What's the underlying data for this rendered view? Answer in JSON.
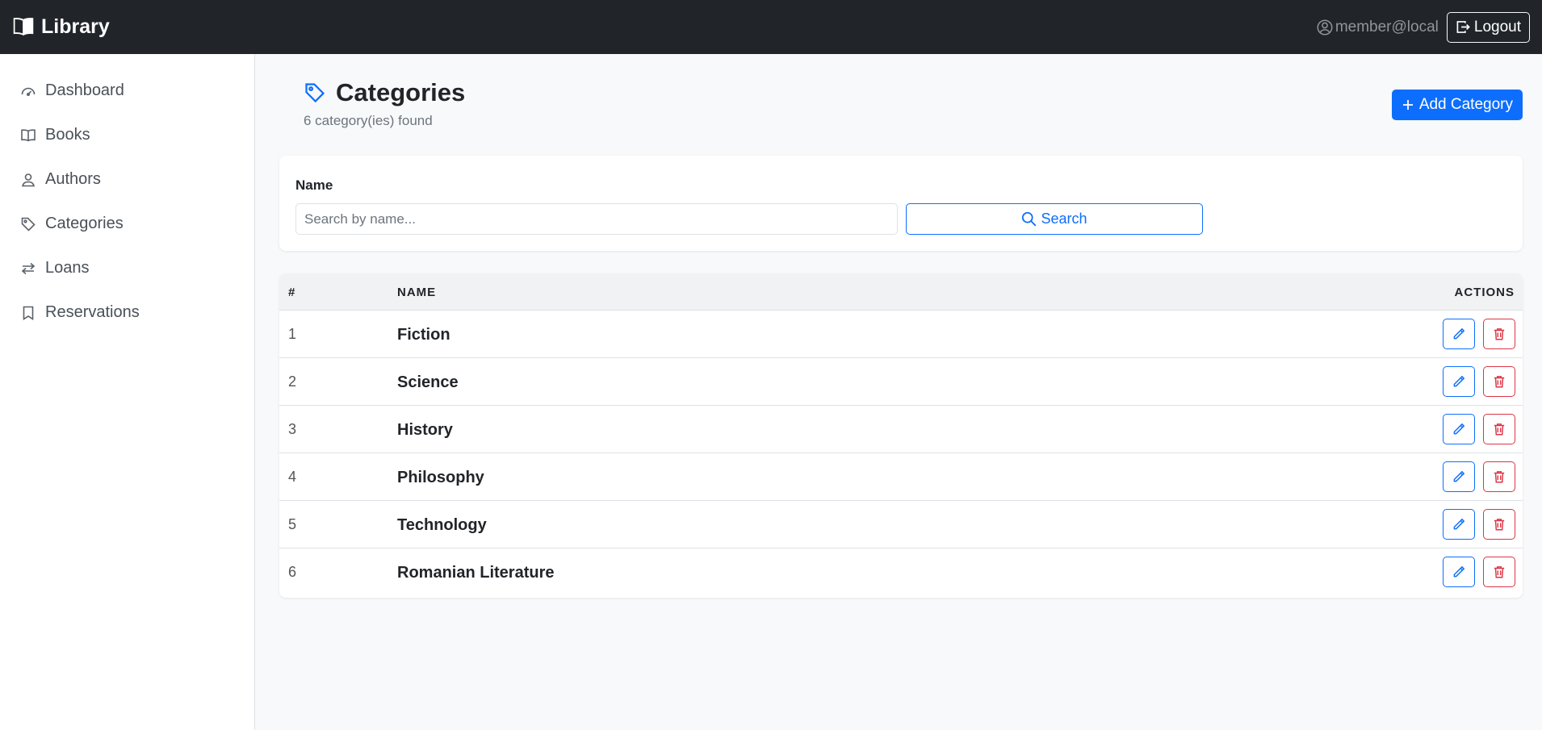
{
  "navbar": {
    "brand": "Library",
    "user": "member@local",
    "logout_label": "Logout"
  },
  "sidebar": {
    "items": [
      {
        "label": "Dashboard",
        "icon": "speedometer-icon"
      },
      {
        "label": "Books",
        "icon": "book-icon"
      },
      {
        "label": "Authors",
        "icon": "person-icon"
      },
      {
        "label": "Categories",
        "icon": "tag-icon"
      },
      {
        "label": "Loans",
        "icon": "arrows-icon"
      },
      {
        "label": "Reservations",
        "icon": "bookmark-icon"
      }
    ]
  },
  "page": {
    "title": "Categories",
    "subtitle": "6 category(ies) found",
    "add_label": "Add Category"
  },
  "filter": {
    "label": "Name",
    "placeholder": "Search by name...",
    "value": "",
    "search_label": "Search"
  },
  "table": {
    "columns": [
      "#",
      "NAME",
      "ACTIONS"
    ],
    "rows": [
      {
        "num": "1",
        "name": "Fiction"
      },
      {
        "num": "2",
        "name": "Science"
      },
      {
        "num": "3",
        "name": "History"
      },
      {
        "num": "4",
        "name": "Philosophy"
      },
      {
        "num": "5",
        "name": "Technology"
      },
      {
        "num": "6",
        "name": "Romanian Literature"
      }
    ]
  },
  "colors": {
    "navbar_bg": "#212529",
    "primary": "#0d6efd",
    "danger": "#dc3545",
    "page_bg": "#f8f9fa"
  }
}
